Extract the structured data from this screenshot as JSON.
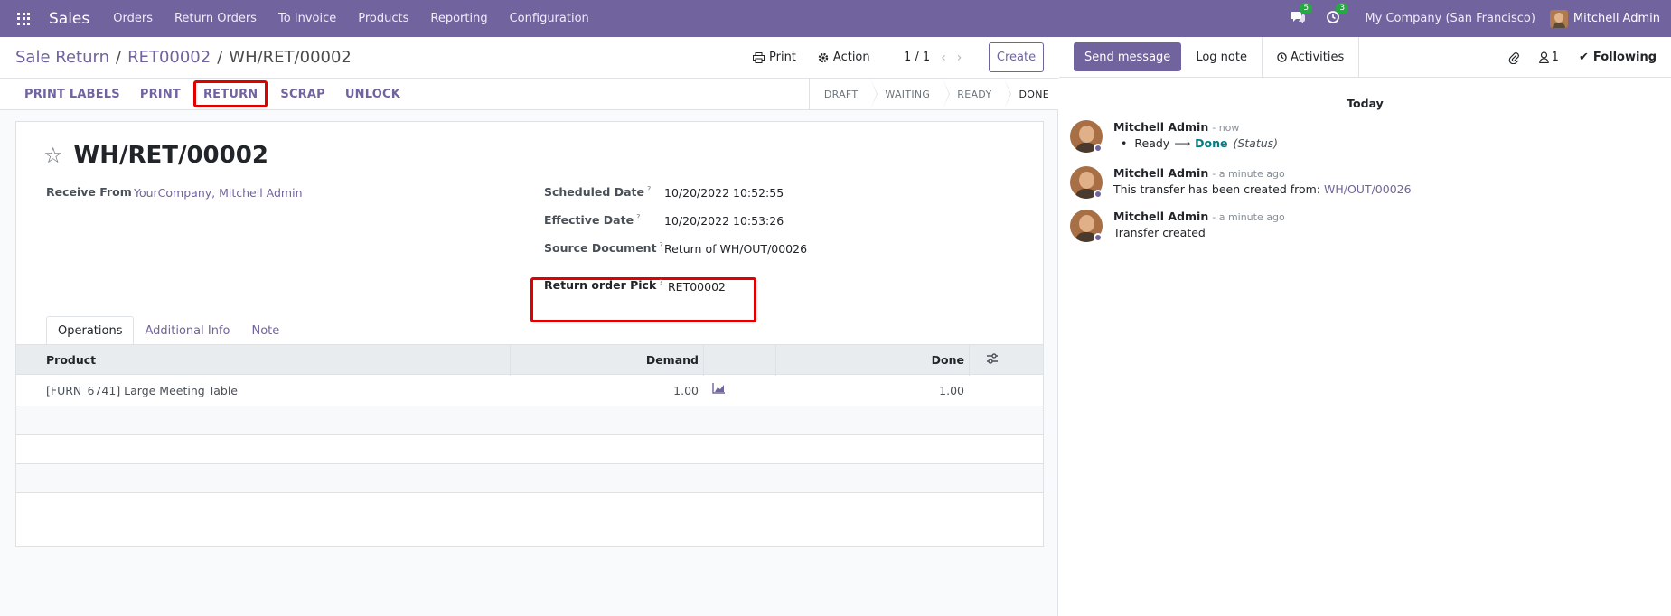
{
  "navbar": {
    "brand": "Sales",
    "menu": [
      "Orders",
      "Return Orders",
      "To Invoice",
      "Products",
      "Reporting",
      "Configuration"
    ],
    "messages_count": "5",
    "activities_count": "3",
    "company": "My Company (San Francisco)",
    "user": "Mitchell Admin"
  },
  "control_panel": {
    "breadcrumb": [
      "Sale Return",
      "RET00002",
      "WH/RET/00002"
    ],
    "print_label": "Print",
    "action_label": "Action",
    "pager": "1 / 1",
    "create_label": "Create"
  },
  "statusbar": {
    "buttons": [
      "PRINT LABELS",
      "PRINT",
      "RETURN",
      "SCRAP",
      "UNLOCK"
    ],
    "stages": [
      "DRAFT",
      "WAITING",
      "READY",
      "DONE"
    ]
  },
  "form": {
    "title": "WH/RET/00002",
    "receive_from_label": "Receive From",
    "receive_from_value": "YourCompany, Mitchell Admin",
    "scheduled_date_label": "Scheduled Date",
    "scheduled_date_value": "10/20/2022 10:52:55",
    "effective_date_label": "Effective Date",
    "effective_date_value": "10/20/2022 10:53:26",
    "source_document_label": "Source Document",
    "source_document_value": "Return of WH/OUT/00026",
    "return_order_pick_label": "Return order Pick",
    "return_order_pick_value": "RET00002",
    "help_mark": "?",
    "tabs": [
      "Operations",
      "Additional Info",
      "Note"
    ]
  },
  "table": {
    "headers": {
      "product": "Product",
      "demand": "Demand",
      "done": "Done"
    },
    "rows": [
      {
        "product": "[FURN_6741] Large Meeting Table",
        "demand": "1.00",
        "done": "1.00"
      }
    ]
  },
  "chatter": {
    "send_message": "Send message",
    "log_note": "Log note",
    "activities": "Activities",
    "followers_count": "1",
    "following": "Following",
    "today": "Today",
    "messages": [
      {
        "author": "Mitchell Admin",
        "when": "- now",
        "old_value": "Ready",
        "new_value": "Done",
        "field": "(Status)"
      },
      {
        "author": "Mitchell Admin",
        "when": "- a minute ago",
        "text": "This transfer has been created from: ",
        "link": "WH/OUT/00026"
      },
      {
        "author": "Mitchell Admin",
        "when": "- a minute ago",
        "text": "Transfer created"
      }
    ]
  },
  "colors": {
    "brand": "#71639e",
    "highlight": "#e00000",
    "success": "#28a745"
  }
}
